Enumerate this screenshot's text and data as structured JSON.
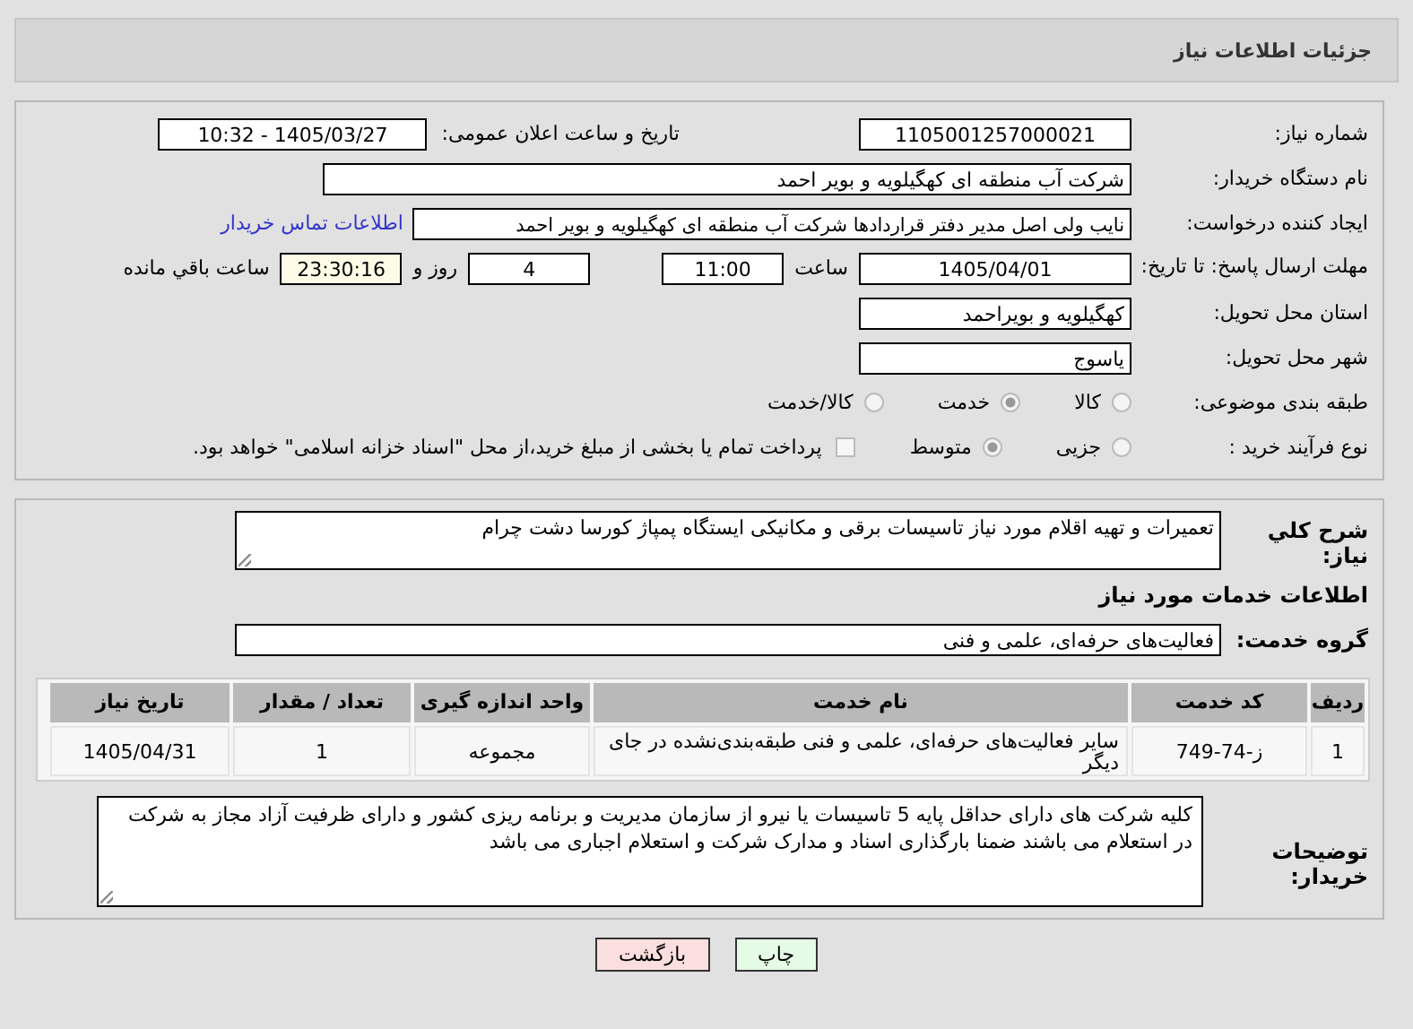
{
  "header": {
    "title": "جزئیات اطلاعات نیاز"
  },
  "need_number": {
    "label": "شماره نیاز:",
    "value": "1105001257000021"
  },
  "announce": {
    "label": "تاریخ و ساعت اعلان عمومی:",
    "value": "1405/03/27 - 10:32"
  },
  "buyer": {
    "label": "نام دستگاه خریدار:",
    "value": "شرکت آب منطقه ای کهگیلویه و بویر احمد"
  },
  "creator": {
    "label": "ایجاد کننده درخواست:",
    "value": "نایب ولی اصل مدیر دفتر قراردادها شرکت آب منطقه ای کهگیلویه و بویر احمد",
    "link": "اطلاعات تماس خریدار"
  },
  "deadline": {
    "label": "مهلت ارسال پاسخ: تا تاریخ:",
    "date": "1405/04/01",
    "time_label": "ساعت",
    "time": "11:00",
    "days": "4",
    "days_label": "روز و",
    "remaining": "23:30:16",
    "remaining_label": "ساعت باقي مانده"
  },
  "province": {
    "label": "استان محل تحویل:",
    "value": "کهگیلویه و بویراحمد"
  },
  "city": {
    "label": "شهر محل تحویل:",
    "value": "یاسوج"
  },
  "category": {
    "label": "طبقه بندی موضوعی:",
    "options": [
      {
        "label": "کالا",
        "selected": false
      },
      {
        "label": "خدمت",
        "selected": true
      },
      {
        "label": "کالا/خدمت",
        "selected": false
      }
    ]
  },
  "purchase_type": {
    "label": "نوع فرآیند خرید :",
    "options": [
      {
        "label": "جزیی",
        "selected": false
      },
      {
        "label": "متوسط",
        "selected": true
      }
    ],
    "treasury": {
      "label": "پرداخت تمام یا بخشی از مبلغ خرید،از محل \"اسناد خزانه اسلامی\" خواهد بود.",
      "checked": false
    }
  },
  "summary": {
    "label": "شرح کلي نیاز:",
    "value": "تعمیرات و تهیه اقلام مورد نیاز تاسیسات برقی و مکانیکی ایستگاه پمپاژ کورسا دشت چرام"
  },
  "services_heading": "اطلاعات خدمات مورد نیاز",
  "service_group": {
    "label": "گروه خدمت:",
    "value": "فعالیت‌های حرفه‌ای، علمی و فنی"
  },
  "table": {
    "columns": [
      "ردیف",
      "کد خدمت",
      "نام خدمت",
      "واحد اندازه گیری",
      "تعداد / مقدار",
      "تاریخ نیاز"
    ],
    "rows": [
      [
        "1",
        "ز-74-749",
        "سایر فعالیت‌های حرفه‌ای، علمی و فنی طبقه‌بندی‌نشده در جای دیگر",
        "مجموعه",
        "1",
        "1405/04/31"
      ]
    ]
  },
  "buyer_notes": {
    "label": "توضیحات خریدار:",
    "value": "کلیه شرکت های دارای حداقل پایه 5 تاسیسات یا نیرو از سازمان مدیریت و برنامه ریزی کشور و دارای ظرفیت آزاد مجاز به شرکت در استعلام می باشند ضمنا بارگذاری اسناد و مدارک شرکت و استعلام اجباری می باشد"
  },
  "buttons": [
    {
      "label": "چاپ",
      "kind": "print"
    },
    {
      "label": "بازگشت",
      "kind": "back"
    }
  ]
}
